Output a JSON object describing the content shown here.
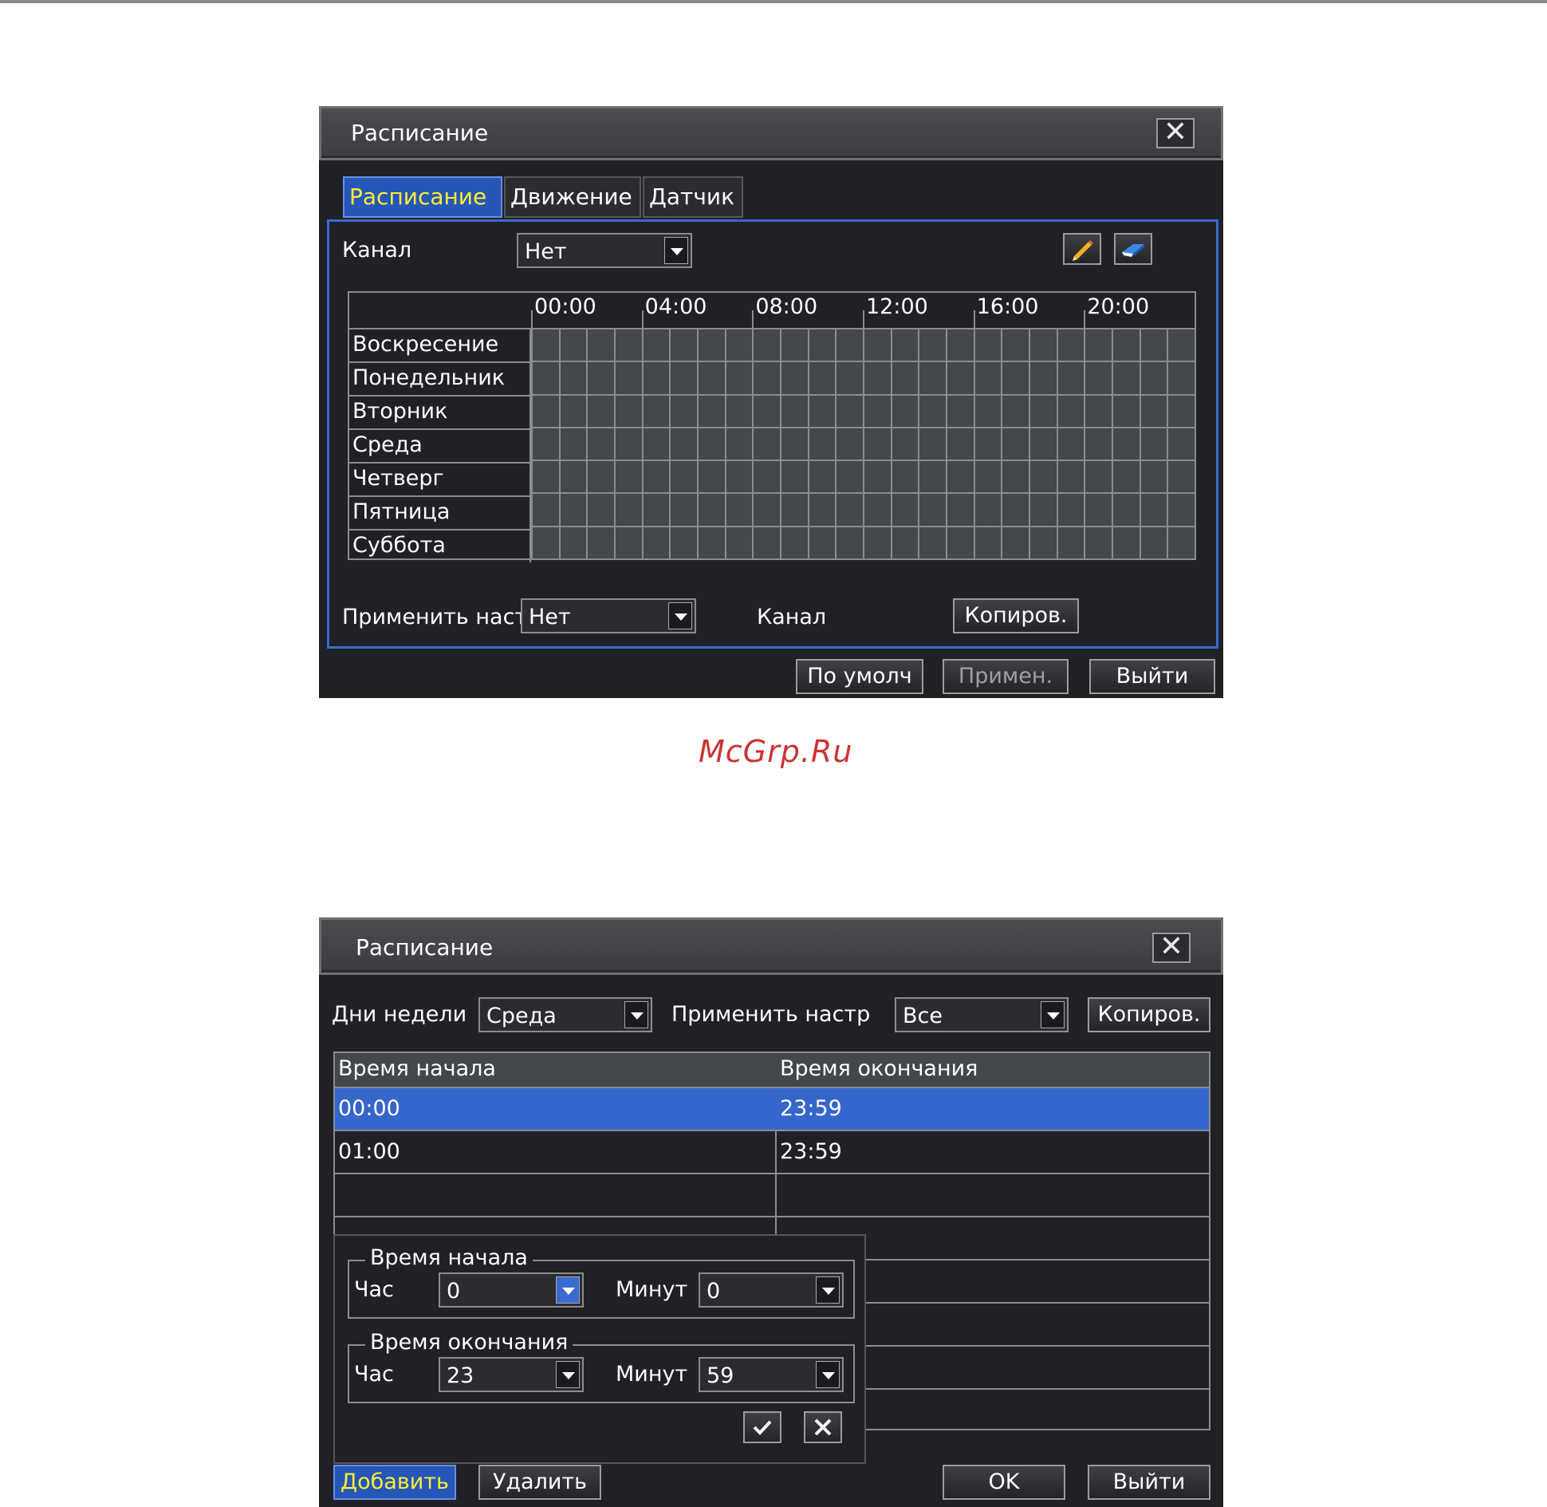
{
  "watermark": "McGrp.Ru",
  "dialog1": {
    "title": "Расписание",
    "tabs": [
      "Расписание",
      "Движение",
      "Датчик"
    ],
    "channel_label": "Канал",
    "channel_value": "Нет",
    "hours": [
      "00:00",
      "04:00",
      "08:00",
      "12:00",
      "16:00",
      "20:00"
    ],
    "days": [
      "Воскресение",
      "Понедельник",
      "Вторник",
      "Среда",
      "Четверг",
      "Пятница",
      "Суббота"
    ],
    "apply_label": "Применить настр",
    "apply_value": "Нет",
    "apply_channel_label": "Канал",
    "copy_label": "Копиров.",
    "default_label": "По умолч",
    "apply_btn_label": "Примен.",
    "exit_label": "Выйти"
  },
  "dialog2": {
    "title": "Расписание",
    "weekday_label": "Дни недели",
    "weekday_value": "Среда",
    "apply_label": "Применить настр",
    "apply_value": "Все",
    "copy_label": "Копиров.",
    "col_start": "Время начала",
    "col_end": "Время окончания",
    "rows": [
      {
        "start": "00:00",
        "end": "23:59"
      },
      {
        "start": "01:00",
        "end": "23:59"
      }
    ],
    "start_group": "Время начала",
    "end_group": "Время окончания",
    "hour_label": "Час",
    "minute_label": "Минут",
    "start_hour": "0",
    "start_minute": "0",
    "end_hour": "23",
    "end_minute": "59",
    "add_label": "Добавить",
    "delete_label": "Удалить",
    "ok_label": "OK",
    "exit_label": "Выйти"
  }
}
